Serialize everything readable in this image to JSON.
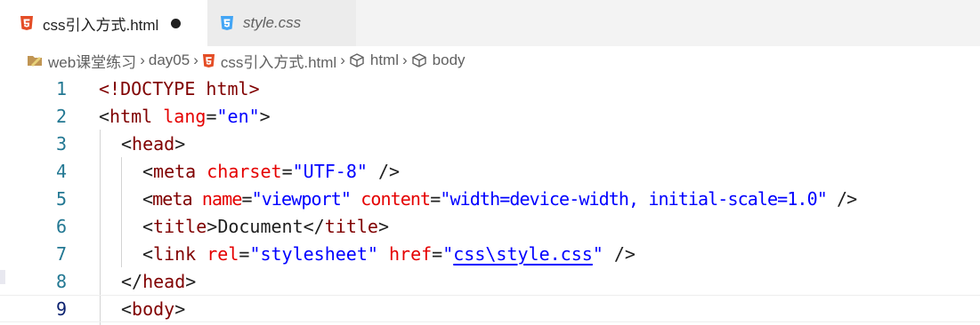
{
  "tabs": [
    {
      "label": "css引入方式.html",
      "modified": true,
      "active": true
    },
    {
      "label": "style.css",
      "modified": false,
      "active": false
    }
  ],
  "breadcrumb": [
    "web课堂练习",
    "day05",
    "css引入方式.html",
    "html",
    "body"
  ],
  "editor": {
    "line_numbers": [
      "1",
      "2",
      "3",
      "4",
      "5",
      "6",
      "7",
      "8",
      "9"
    ],
    "code": {
      "l1": {
        "p1": "<!DOCTYPE ",
        "p2": "html",
        "p3": ">"
      },
      "l2": {
        "p1": "<",
        "p2": "html",
        "p3": " ",
        "p4": "lang",
        "p5": "=",
        "p6": "\"en\"",
        "p7": ">"
      },
      "l3": {
        "p1": "<",
        "p2": "head",
        "p3": ">"
      },
      "l4": {
        "p1": "<",
        "p2": "meta",
        "p3": " ",
        "p4": "charset",
        "p5": "=",
        "p6": "\"UTF-8\"",
        "p7": " />"
      },
      "l5": {
        "p1": "<",
        "p2": "meta",
        "p3": " ",
        "p4": "name",
        "p5": "=",
        "p6": "\"viewport\"",
        "p7": " ",
        "p8": "content",
        "p9": "=",
        "p10": "\"width=device-width, initial-scale=1.0\"",
        "p11": " />"
      },
      "l6": {
        "p1": "<",
        "p2": "title",
        "p3": ">",
        "p4": "Document",
        "p5": "</",
        "p6": "title",
        "p7": ">"
      },
      "l7": {
        "p1": "<",
        "p2": "link",
        "p3": " ",
        "p4": "rel",
        "p5": "=",
        "p6": "\"stylesheet\"",
        "p7": " ",
        "p8": "href",
        "p9": "=",
        "p10": "\"",
        "p11": "css\\style.css",
        "p12": "\"",
        "p13": " />"
      },
      "l8": {
        "p1": "</",
        "p2": "head",
        "p3": ">"
      },
      "l9": {
        "p1": "<",
        "p2": "body",
        "p3": ">"
      }
    }
  },
  "colors": {
    "html_icon": "#e44d26",
    "css_icon": "#42a5f5",
    "folder_icon": "#c09553",
    "line_number": "#237893",
    "tag": "#800000",
    "attribute": "#e50000",
    "value": "#0000ff"
  }
}
